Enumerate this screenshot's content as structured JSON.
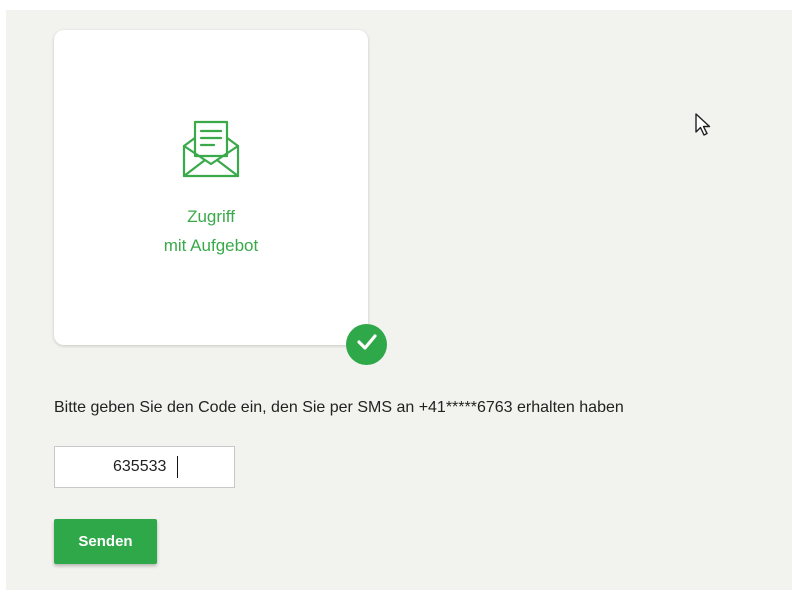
{
  "card": {
    "icon": "envelope-letter-icon",
    "label_line1": "Zugriff",
    "label_line2": "mit Aufgebot",
    "selected": true
  },
  "badge": {
    "icon": "checkmark-icon"
  },
  "instruction_text": "Bitte geben Sie den Code ein, den Sie per SMS an +41*****6763 erhalten haben",
  "code_input": {
    "value": "635533"
  },
  "send_button": {
    "label": "Senden"
  },
  "colors": {
    "accent_green": "#2fa84a",
    "label_green": "#3aa94a",
    "panel_background": "#f2f2ee"
  }
}
